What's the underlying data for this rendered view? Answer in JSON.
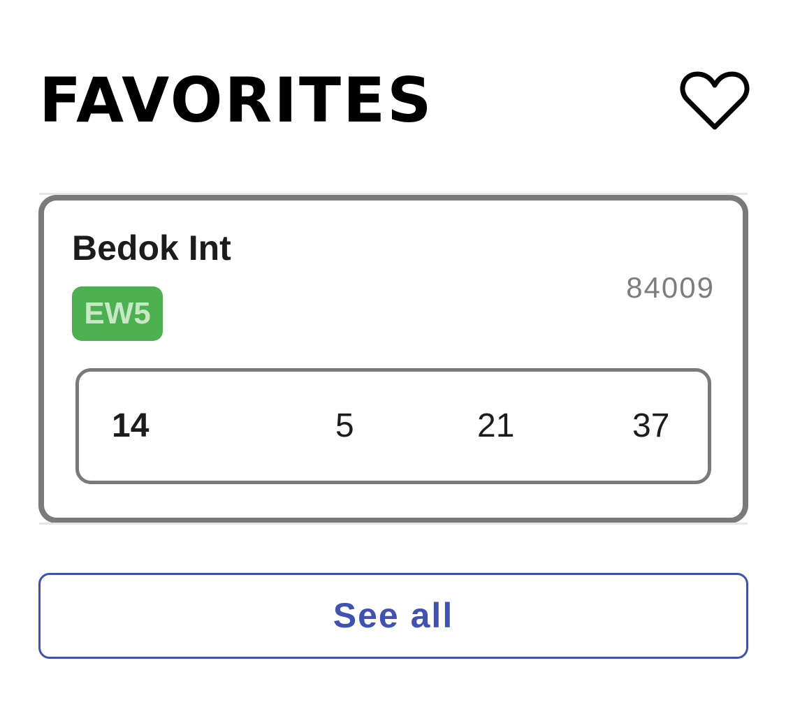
{
  "header": {
    "title": "FAVORITES",
    "favorite_icon": "heart-outline-icon"
  },
  "favorites": [
    {
      "stop_name": "Bedok Int",
      "stop_code": "84009",
      "mrt_code": "EW5",
      "mrt_color": "#4caf50",
      "services": [
        "14",
        "5",
        "21",
        "37"
      ]
    }
  ],
  "see_all": {
    "label": "See all",
    "color": "#3f51b5"
  }
}
